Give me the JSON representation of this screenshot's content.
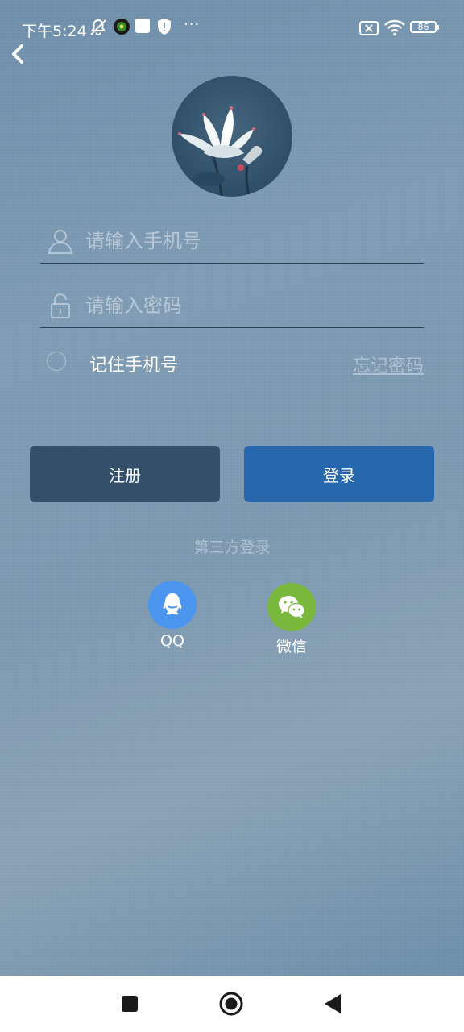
{
  "status_bar": {
    "time": "下午5:24",
    "battery": "86",
    "icons": [
      "mute-icon",
      "app-icon",
      "square-icon",
      "shield-icon",
      "more-icon",
      "no-sim-icon",
      "wifi-icon",
      "battery-icon"
    ]
  },
  "login": {
    "phone_placeholder": "请输入手机号",
    "password_placeholder": "请输入密码",
    "remember_label": "记住手机号",
    "forgot_label": "忘记密码",
    "register_label": "注册",
    "login_label": "登录",
    "third_party_title": "第三方登录",
    "qq_label": "QQ",
    "wechat_label": "微信"
  },
  "colors": {
    "register_button": "#344f6a",
    "login_button": "#2767ad",
    "qq": "#4b95ef",
    "wechat": "#7ab73d"
  }
}
